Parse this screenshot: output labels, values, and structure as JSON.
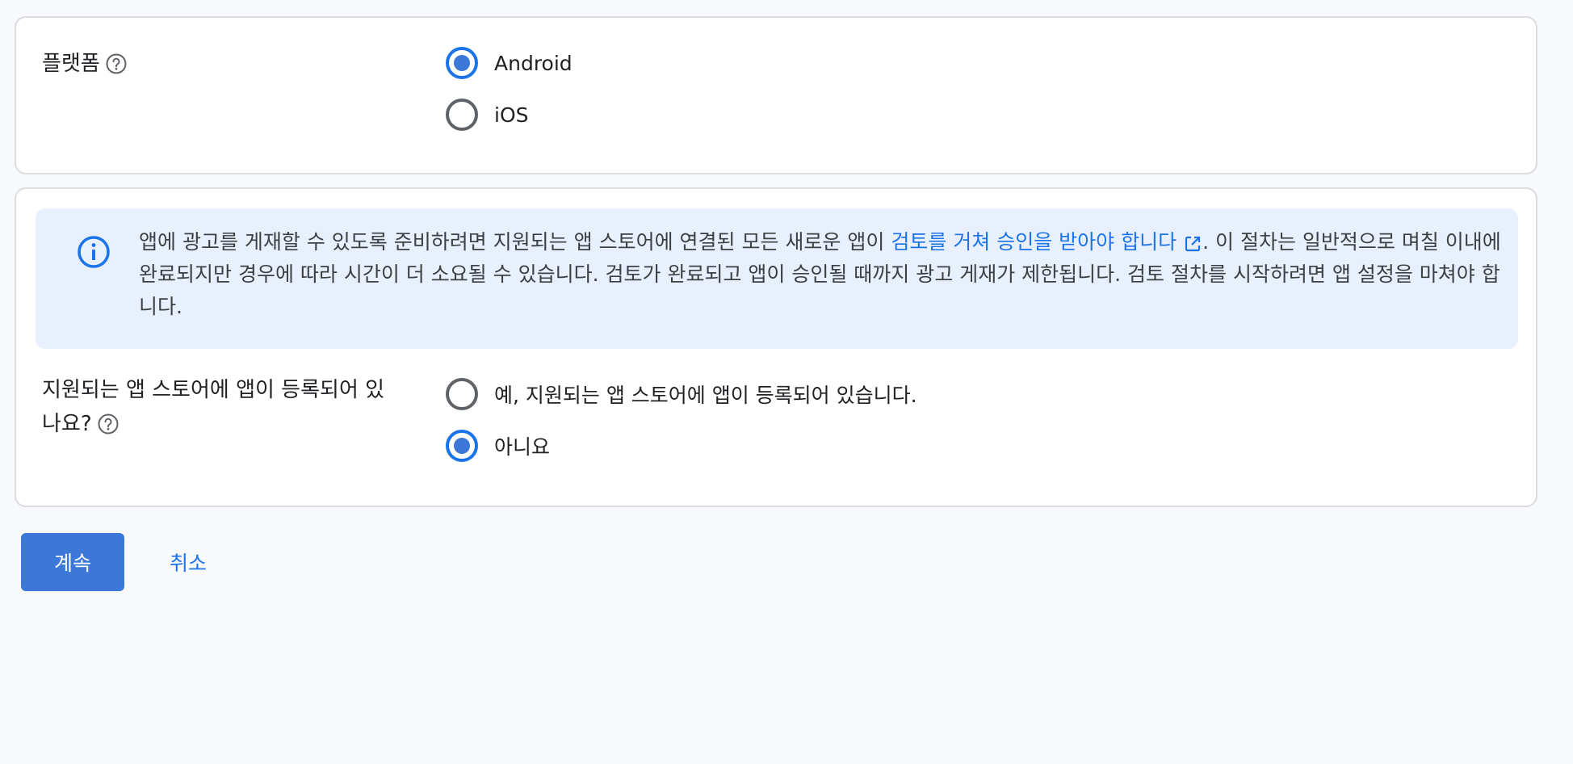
{
  "platform": {
    "label": "플랫폼",
    "options": [
      {
        "label": "Android",
        "checked": true
      },
      {
        "label": "iOS",
        "checked": false
      }
    ]
  },
  "info": {
    "text_before": "앱에 광고를 게재할 수 있도록 준비하려면 지원되는 앱 스토어에 연결된 모든 새로운 앱이 ",
    "link_text": "검토를 거쳐 승인을 받아야 합니다",
    "text_after": ". 이 절차는 일반적으로 며칠 이내에 완료되지만 경우에 따라 시간이 더 소요될 수 있습니다. 검토가 완료되고 앱이 승인될 때까지 광고 게재가 제한됩니다. 검토 절차를 시작하려면 앱 설정을 마쳐야 합니다."
  },
  "store": {
    "label_line1": "지원되는 앱 스토어에 앱이 등록되어 있",
    "label_line2": "나요?",
    "options": [
      {
        "label": "예, 지원되는 앱 스토어에 앱이 등록되어 있습니다.",
        "checked": false
      },
      {
        "label": "아니요",
        "checked": true
      }
    ]
  },
  "actions": {
    "continue_label": "계속",
    "cancel_label": "취소"
  },
  "colors": {
    "accent": "#1a73e8",
    "primary_button": "#3c78d8",
    "info_background": "#e8f0fe",
    "page_background": "#f8f9fa"
  },
  "icons": {
    "help": "help-circle-icon",
    "info": "info-icon",
    "external_link": "open-in-new-icon"
  }
}
